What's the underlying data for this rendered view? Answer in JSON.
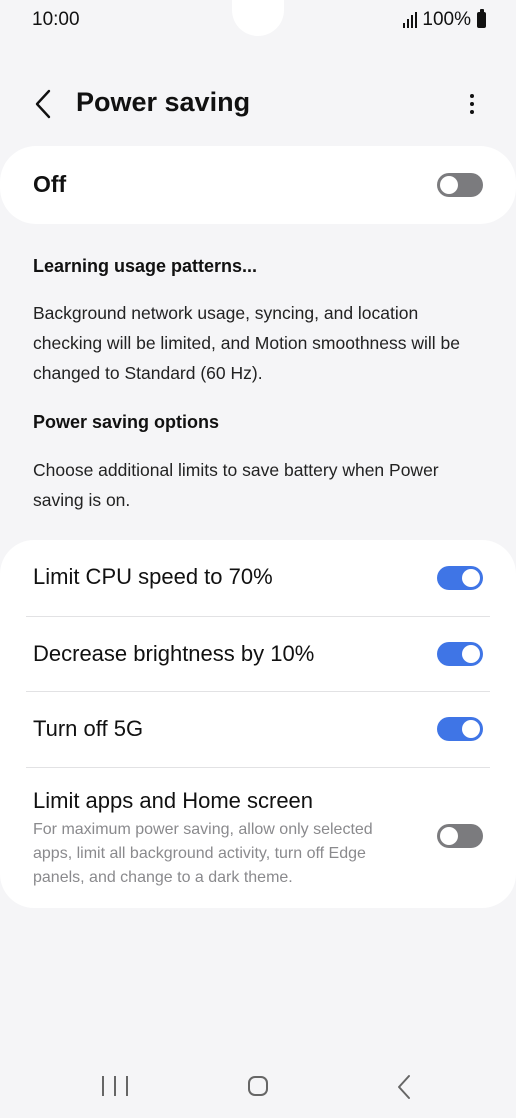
{
  "status_bar": {
    "time": "10:00",
    "battery": "100%",
    "icons": [
      "signal-icon",
      "battery-icon"
    ]
  },
  "header": {
    "title": "Power saving",
    "back_icon": "chevron-left-icon",
    "more_icon": "more-vertical-icon"
  },
  "master_switch": {
    "label": "Off",
    "enabled": false
  },
  "info": {
    "learning_heading": "Learning usage patterns...",
    "learning_text": "Background network usage, syncing, and location checking will be limited, and Motion smoothness will be changed to Standard (60 Hz).",
    "options_heading": "Power saving options",
    "options_text": "Choose additional limits to save battery when Power saving is on."
  },
  "options": [
    {
      "label": "Limit CPU speed to 70%",
      "description": "",
      "enabled": true
    },
    {
      "label": "Decrease brightness by 10%",
      "description": "",
      "enabled": true
    },
    {
      "label": "Turn off 5G",
      "description": "",
      "enabled": true
    },
    {
      "label": "Limit apps and Home screen",
      "description": "For maximum power saving, allow only selected apps, limit all background activity, turn off Edge panels, and change to a dark theme.",
      "enabled": false
    }
  ],
  "nav_bar": {
    "icons": [
      "recents-icon",
      "home-icon",
      "back-icon"
    ]
  },
  "colors": {
    "toggle_on": "#3f75e6",
    "toggle_off": "#7b7b7e",
    "background": "#f5f5f7",
    "card": "#ffffff"
  }
}
